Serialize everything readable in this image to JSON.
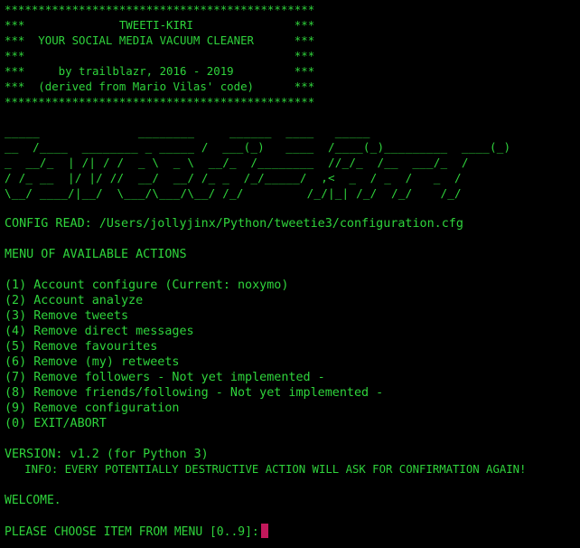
{
  "terminal": {
    "colors": {
      "background": "#000000",
      "text": "#2fd43c",
      "cursor": "#c2185b"
    },
    "banner": [
      "**********************************************",
      "***              TWEETI-KIRI               ***",
      "***  YOUR SOCIAL MEDIA VACUUM CLEANER      ***",
      "***                                        ***",
      "***     by trailblazr, 2016 - 2019         ***",
      "***  (derived from Mario Vilas' code)      ***",
      "**********************************************"
    ],
    "ascii_art": [
      "_____              ________     ______  ____   _____",
      "__  /____  ________ _ _____ /  ___(_)   ____  /____(_)_________  ____(_)",
      "_  __/_  | /| / /  _ \\  _ \\  __/_  /________  //_/_  /__  ___/_  /",
      "/ /_ __  |/ |/ //  __/  __/ /_ _  /_/_____/  ,<  _  / _  /   _  /",
      "\\__/ ____/|__/  \\___/\\___/\\__/ /_/         /_/|_| /_/  /_/    /_/"
    ],
    "config": {
      "label": "CONFIG READ:",
      "path": "/Users/jollyjinx/Python/tweetie3/configuration.cfg"
    },
    "menu": {
      "title": "MENU OF AVAILABLE ACTIONS",
      "items": [
        "(1) Account configure (Current: noxymo)",
        "(2) Account analyze",
        "(3) Remove tweets",
        "(4) Remove direct messages",
        "(5) Remove favourites",
        "(6) Remove (my) retweets",
        "(7) Remove followers - Not yet implemented -",
        "(8) Remove friends/following - Not yet implemented -",
        "(9) Remove configuration",
        "(0) EXIT/ABORT"
      ]
    },
    "version": "VERSION: v1.2 (for Python 3)",
    "info": "   INFO: EVERY POTENTIALLY DESTRUCTIVE ACTION WILL ASK FOR CONFIRMATION AGAIN!",
    "welcome": "WELCOME.",
    "prompt": "PLEASE CHOOSE ITEM FROM MENU [0..9]:"
  }
}
